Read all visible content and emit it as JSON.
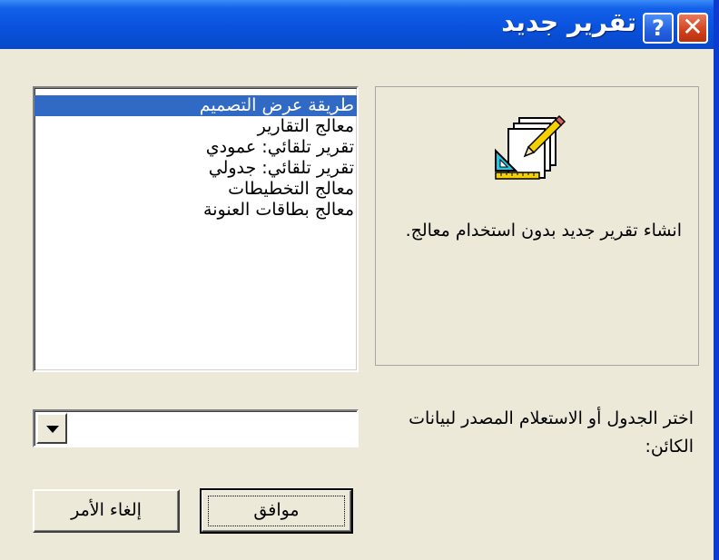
{
  "window": {
    "title": "تقرير جديد",
    "help_label": "?",
    "close_label": "✕"
  },
  "wizard_list": {
    "items": [
      {
        "label": "طريقة عرض التصميم",
        "selected": true
      },
      {
        "label": "معالج التقارير",
        "selected": false
      },
      {
        "label": "تقرير تلقائي: عمودي",
        "selected": false
      },
      {
        "label": "تقرير تلقائي: جدولي",
        "selected": false
      },
      {
        "label": "معالج التخطيطات",
        "selected": false
      },
      {
        "label": "معالج بطاقات العنونة",
        "selected": false
      }
    ]
  },
  "preview": {
    "icon": "report-wizard-icon",
    "description": "انشاء تقرير جديد بدون استخدام معالج."
  },
  "source": {
    "label": "اختر الجدول أو الاستعلام المصدر لبيانات الكائن:",
    "value": ""
  },
  "buttons": {
    "ok_label": "موافق",
    "cancel_label": "إلغاء الأمر"
  },
  "colors": {
    "titlebar": "#0a52de",
    "selection": "#316ac5",
    "dialog_face": "#ece9d8"
  }
}
